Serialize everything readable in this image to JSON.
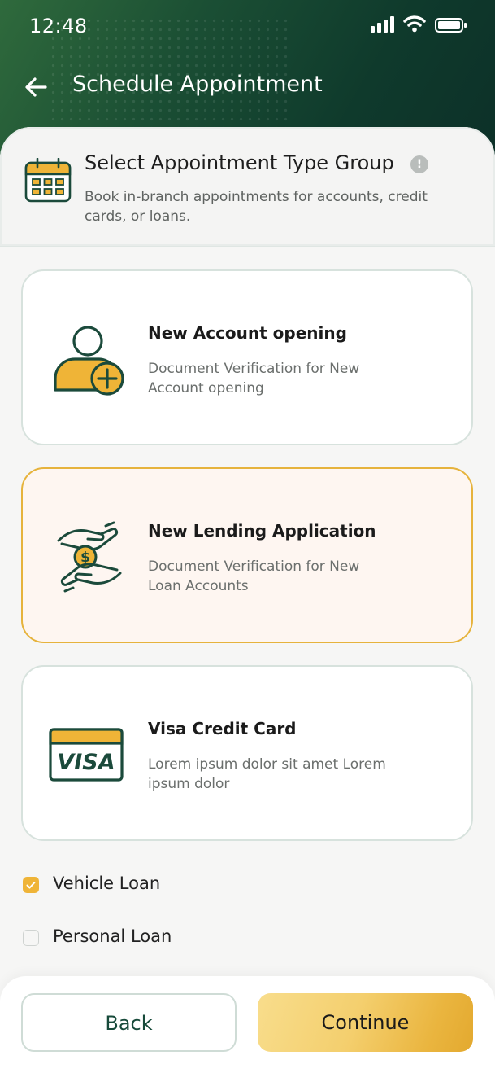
{
  "status_bar": {
    "time": "12:48"
  },
  "header": {
    "title": "Schedule Appointment"
  },
  "group": {
    "title": "Select Appointment Type Group",
    "info": "!",
    "description": "Book in-branch appointments for accounts, credit cards, or loans."
  },
  "cards": [
    {
      "title": "New Account opening",
      "description": "Document Verification for New Account opening",
      "icon": "user-add-icon",
      "selected": false
    },
    {
      "title": "New Lending Application",
      "description": "Document Verification for New Loan Accounts",
      "icon": "hands-coin-icon",
      "selected": true
    },
    {
      "title": "Visa Credit Card",
      "description": "Lorem ipsum dolor sit amet Lorem ipsum dolor",
      "icon": "visa-card-icon",
      "selected": false
    }
  ],
  "visa_logo_text": "VISA",
  "options": [
    {
      "label": "Vehicle Loan",
      "checked": true
    },
    {
      "label": "Personal Loan",
      "checked": false
    }
  ],
  "footer": {
    "back_label": "Back",
    "continue_label": "Continue"
  },
  "colors": {
    "brand_dark_green": "#0f3a2c",
    "accent_gold": "#efb437",
    "selected_bg": "#fef6f1"
  }
}
